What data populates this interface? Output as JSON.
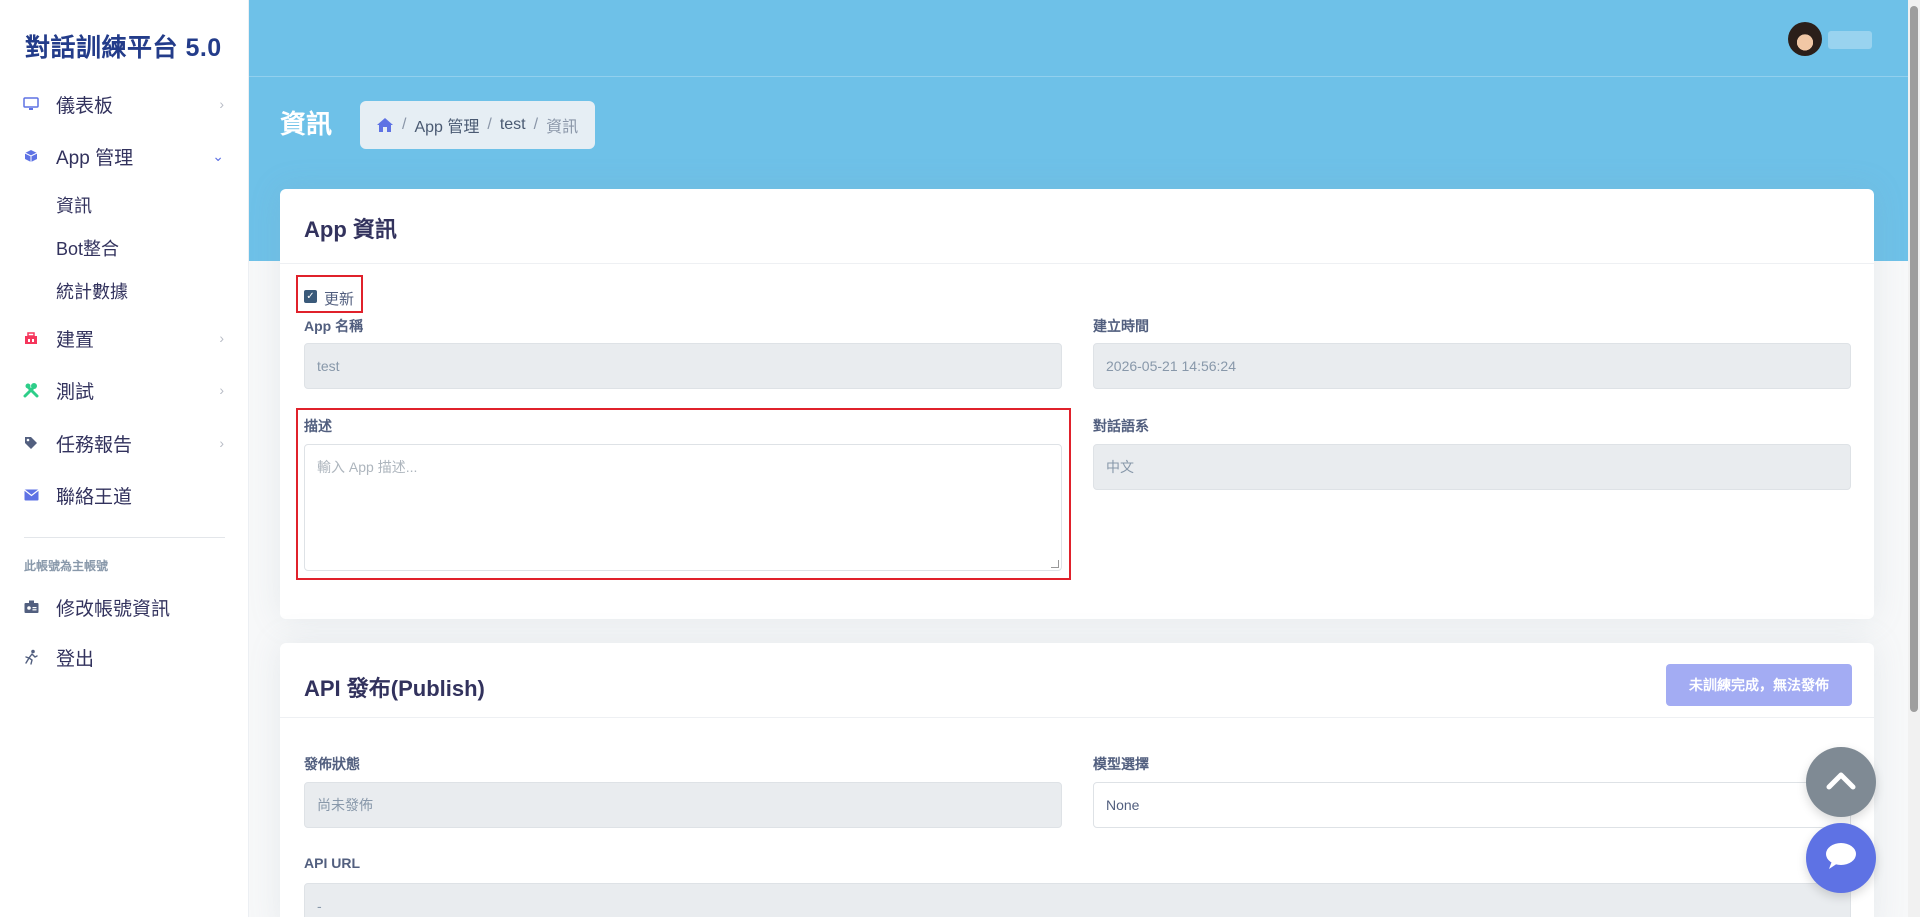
{
  "brand": "對話訓練平台 5.0",
  "sidebar": {
    "items": [
      {
        "label": "儀表板"
      },
      {
        "label": "App 管理",
        "sub": [
          "資訊",
          "Bot整合",
          "統計數據"
        ]
      },
      {
        "label": "建置"
      },
      {
        "label": "測試"
      },
      {
        "label": "任務報告"
      },
      {
        "label": "聯絡王道"
      }
    ],
    "caption": "此帳號為主帳號",
    "account_items": [
      {
        "label": "修改帳號資訊"
      },
      {
        "label": "登出"
      }
    ]
  },
  "header": {
    "page_title": "資訊",
    "breadcrumb": [
      "App 管理",
      "test",
      "資訊"
    ]
  },
  "app_info": {
    "title": "App 資訊",
    "update_label": "更新",
    "name_label": "App 名稱",
    "name_value": "test",
    "created_label": "建立時間",
    "created_value": "2026-05-21 14:56:24",
    "desc_label": "描述",
    "desc_placeholder": "輸入 App 描述...",
    "lang_label": "對話語系",
    "lang_value": "中文"
  },
  "api_publish": {
    "title": "API 發布(Publish)",
    "button": "未訓練完成，無法發佈",
    "status_label": "發佈狀態",
    "status_value": "尚未發佈",
    "model_label": "模型選擇",
    "model_value": "None",
    "url_label": "API URL",
    "url_value": "-"
  },
  "colors": {
    "header": "#6ec1e8",
    "primary": "#5e72e4",
    "brand": "#233c8a",
    "highlight": "#e0212b"
  }
}
